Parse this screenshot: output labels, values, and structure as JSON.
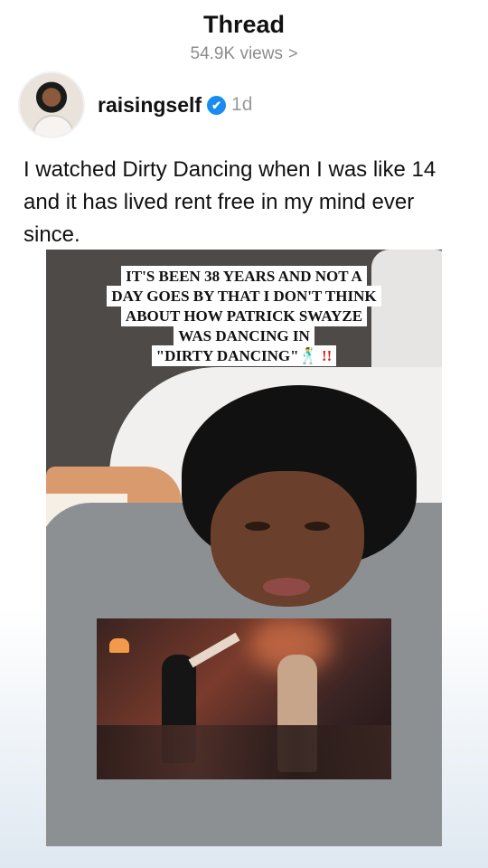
{
  "header": {
    "title": "Thread",
    "views": "54.9K views",
    "views_chevron": ">"
  },
  "post": {
    "username": "raisingself",
    "verified_icon": "✔",
    "time": "1d",
    "text": "I watched Dirty Dancing when I was like 14 and it has lived rent free in my mind ever since."
  },
  "media": {
    "caption_lines": [
      "IT'S BEEN 38 YEARS AND NOT A",
      "DAY GOES BY THAT I DON'T THINK",
      "ABOUT HOW PATRICK SWAYZE",
      "WAS DANCING IN"
    ],
    "caption_last": "\"DIRTY DANCING\"",
    "caption_emoji": "🕺",
    "caption_bang": "!!"
  },
  "colors": {
    "verified": "#1a8cf0",
    "muted_text": "#8c8c8c"
  }
}
